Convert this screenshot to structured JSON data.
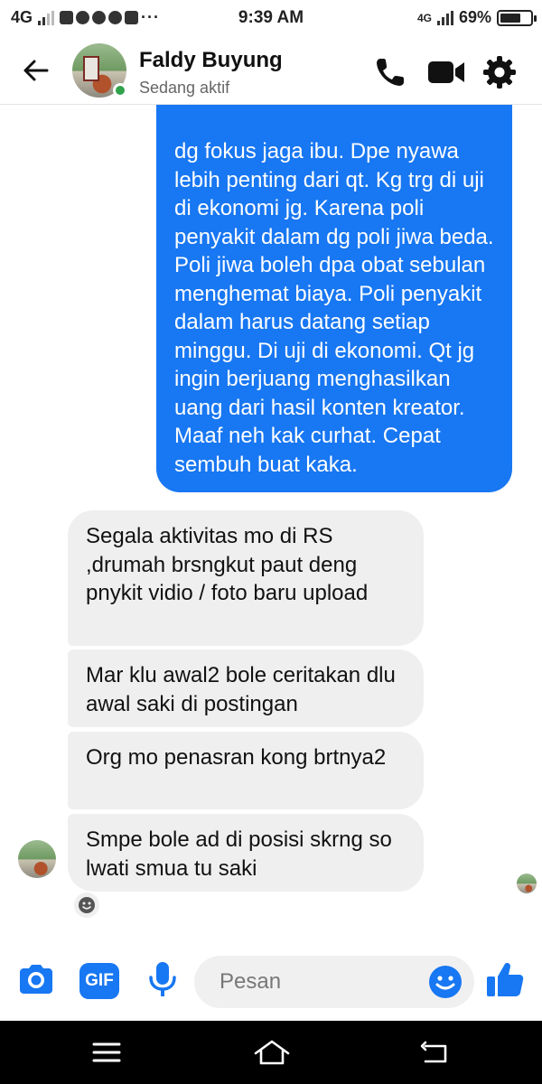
{
  "status_bar": {
    "network": "4G",
    "network_right": "4G",
    "time": "9:39 AM",
    "battery": "69%",
    "battery_level": 0.69,
    "notification_icons": [
      "facebook-icon",
      "messenger-icon",
      "chat-icon",
      "twitter-icon",
      "instagram-icon",
      "more-dots-icon"
    ]
  },
  "header": {
    "contact_name": "Faldy Buyung",
    "presence": "Sedang aktif",
    "icons": [
      "back-arrow-icon",
      "phone-icon",
      "video-icon",
      "gear-icon"
    ]
  },
  "messages": [
    {
      "direction": "outgoing",
      "text": "dg fokus jaga ibu. Dpe nyawa lebih penting dari qt. Kg trg di uji di ekonomi jg. Karena poli penyakit dalam dg poli jiwa beda. Poli jiwa boleh dpa obat sebulan menghemat biaya. Poli penyakit dalam harus datang setiap minggu. Di uji di ekonomi. Qt jg ingin berjuang menghasilkan uang dari hasil konten kreator. Maaf neh kak curhat. Cepat sembuh buat kaka."
    },
    {
      "direction": "incoming",
      "text": "Segala aktivitas mo di RS ,drumah  brsngkut paut deng pnykit vidio / foto baru upload"
    },
    {
      "direction": "incoming",
      "text": "Mar klu awal2 bole ceritakan dlu awal saki di postingan"
    },
    {
      "direction": "incoming",
      "text": "Org mo penasran kong brtnya2"
    },
    {
      "direction": "incoming",
      "text": "Smpe bole ad di posisi skrng so lwati smua tu saki"
    }
  ],
  "composer": {
    "placeholder": "Pesan",
    "gif_label": "GIF",
    "icons": [
      "camera-icon",
      "gif-icon",
      "microphone-icon",
      "emoji-icon",
      "thumbs-up-icon"
    ]
  },
  "navbar": {
    "icons": [
      "menu-icon",
      "home-icon",
      "back-icon"
    ]
  },
  "colors": {
    "accent": "#1877f2",
    "incoming_bubble": "#efefef",
    "online": "#31a24c"
  }
}
